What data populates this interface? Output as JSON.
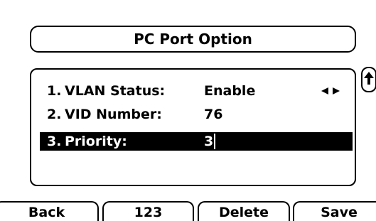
{
  "title": "PC Port Option",
  "menu": {
    "items": [
      {
        "index": "1.",
        "label": "VLAN Status:",
        "value": "Enable",
        "control": "left-right-arrows-icon"
      },
      {
        "index": "2.",
        "label": "VID Number:",
        "value": "76"
      },
      {
        "index": "3.",
        "label": "Priority:",
        "value": "3",
        "selected": true
      }
    ]
  },
  "scroll_indicator": "scroll-up-icon",
  "softkeys": {
    "back": "Back",
    "input_mode": "123",
    "delete": "Delete",
    "save": "Save"
  },
  "colors": {
    "background": "#ffffff",
    "foreground": "#000000",
    "selection": "#000000"
  }
}
